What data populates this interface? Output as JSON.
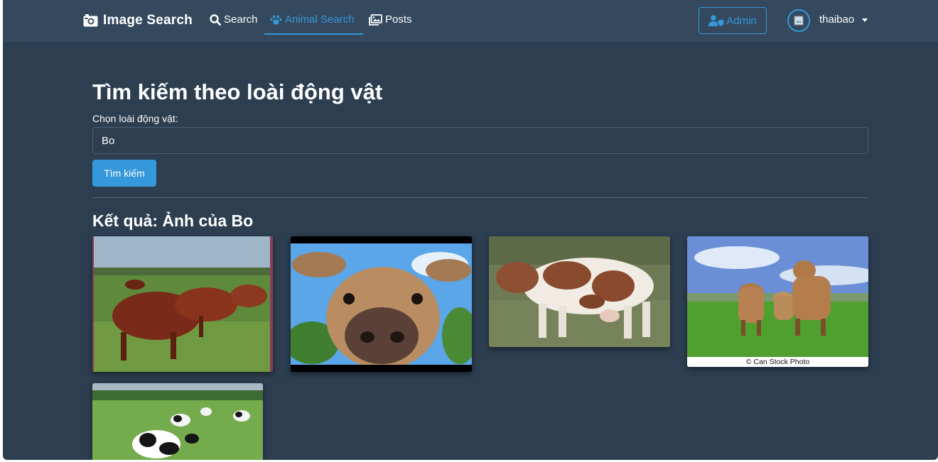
{
  "navbar": {
    "brand": "Image Search",
    "brand_icon": "camera-icon",
    "items": [
      {
        "label": "Search",
        "icon": "search-icon"
      },
      {
        "label": "Animal Search",
        "icon": "paw-icon",
        "active": true
      },
      {
        "label": "Posts",
        "icon": "images-icon"
      }
    ],
    "admin_label": "Admin",
    "user_name": "thaibao"
  },
  "page": {
    "title": "Tìm kiếm theo loài động vật",
    "field_label": "Chọn loài động vật:",
    "search_value": "Bo",
    "submit_label": "Tìm kiếm",
    "results_title": "Kết quả: Ảnh của Bo"
  },
  "results": {
    "images": [
      {
        "alt": "Brown cows grazing in a field"
      },
      {
        "alt": "Close-up of a brown cow face"
      },
      {
        "alt": "Brown and white spotted cow"
      },
      {
        "alt": "Three cows in a green field",
        "caption": "© Can Stock Photo"
      },
      {
        "alt": "Black and white cows in a pasture"
      }
    ]
  },
  "colors": {
    "background": "#2c3e50",
    "navbar": "#34495e",
    "accent": "#3498db",
    "text": "#ffffff"
  }
}
